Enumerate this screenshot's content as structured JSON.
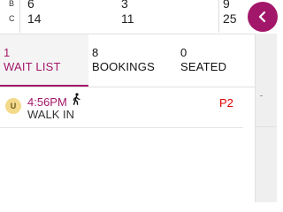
{
  "counts": {
    "rows": [
      {
        "label": "B",
        "values": [
          "6",
          "3",
          "9"
        ]
      },
      {
        "label": "C",
        "values": [
          "14",
          "11",
          "25"
        ]
      }
    ]
  },
  "tabs": [
    {
      "count": "1",
      "label": "WAIT LIST",
      "active": true
    },
    {
      "count": "8",
      "label": "BOOKINGS",
      "active": false
    },
    {
      "count": "0",
      "label": "SEATED",
      "active": false
    }
  ],
  "entry": {
    "avatar": "U",
    "time": "4:56PM",
    "party": "WALK IN",
    "priority": "P2",
    "icon": "walk-in-icon"
  },
  "colors": {
    "accent": "#a3176a",
    "priority": "#e00000"
  }
}
